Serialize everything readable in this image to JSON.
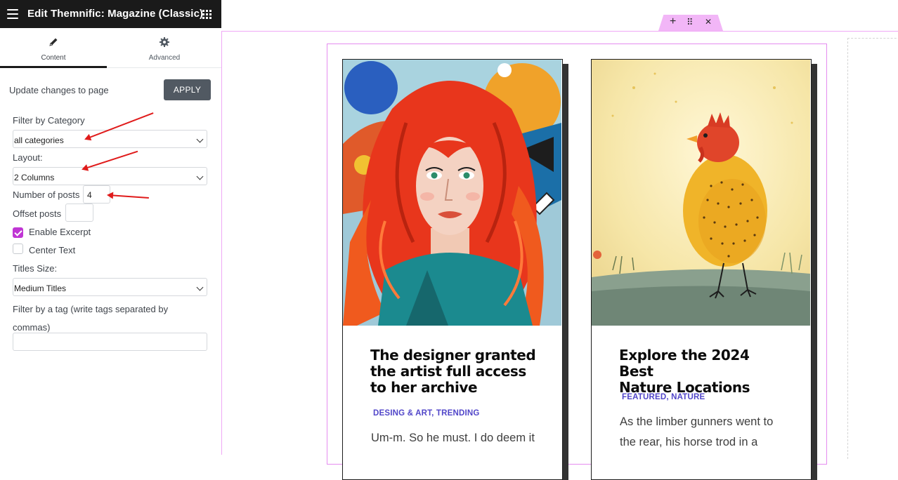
{
  "panel": {
    "title": "Edit Themnific: Magazine (Classic)",
    "tabs": [
      {
        "label": "Content",
        "icon": "pencil-icon",
        "active": true
      },
      {
        "label": "Advanced",
        "icon": "gear-icon",
        "active": false
      }
    ],
    "update_text": "Update changes to page",
    "apply_label": "APPLY",
    "filter_category": {
      "label": "Filter by Category",
      "value": "all categories"
    },
    "layout": {
      "label": "Layout:",
      "value": "2 Columns"
    },
    "num_posts": {
      "label": "Number of posts",
      "value": "4"
    },
    "offset_posts": {
      "label": "Offset posts",
      "value": ""
    },
    "enable_excerpt": {
      "label": "Enable Excerpt",
      "checked": true
    },
    "center_text": {
      "label": "Center Text",
      "checked": false
    },
    "titles_size": {
      "label": "Titles Size:",
      "value": "Medium Titles"
    },
    "filter_tag": {
      "label_line1": "Filter by a tag (write tags separated by",
      "label_line2": "commas)",
      "value": ""
    }
  },
  "section_handle": {
    "add": "+",
    "move": "⠿",
    "close": "✕"
  },
  "posts": [
    {
      "title_lines": [
        "The designer granted",
        "the artist full access",
        "to her archive"
      ],
      "categories": "DESING & ART, TRENDING",
      "excerpt_line": "Um-m. So he must. I do deem it"
    },
    {
      "title_lines": [
        "Explore the 2024 Best",
        "Nature Locations"
      ],
      "categories": "FEATURED, NATURE",
      "excerpt_lines": [
        "As the limber gunners went to",
        "the rear, his horse trod in a"
      ]
    }
  ],
  "colors": {
    "accent_checkbox": "#c036d4",
    "category_link": "#5146c9",
    "annotation_arrow": "#e01b1b",
    "editor_outline": "#e58cf0"
  }
}
